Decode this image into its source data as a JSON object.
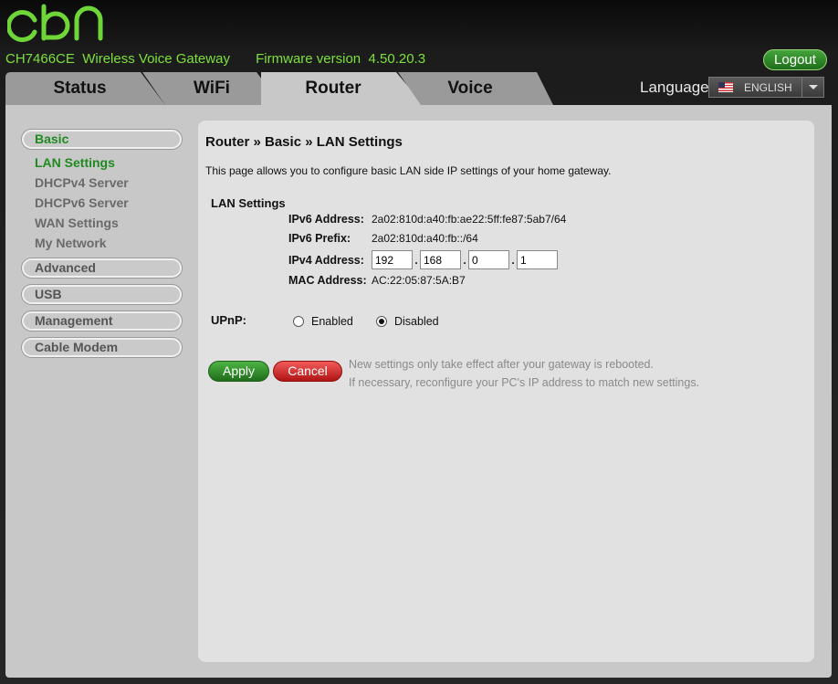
{
  "header": {
    "model": "CH7466CE",
    "product": "Wireless Voice Gateway",
    "firmware_label": "Firmware version",
    "firmware_version": "4.50.20.3",
    "logout_label": "Logout",
    "language_label": "Language",
    "language_value": "ENGLISH"
  },
  "tabs": [
    {
      "label": "Status"
    },
    {
      "label": "WiFi"
    },
    {
      "label": "Router",
      "active": true
    },
    {
      "label": "Voice"
    }
  ],
  "sidebar": {
    "basic": "Basic",
    "items": [
      "LAN Settings",
      "DHCPv4 Server",
      "DHCPv6 Server",
      "WAN Settings",
      "My Network"
    ],
    "advanced": "Advanced",
    "usb": "USB",
    "management": "Management",
    "cable_modem": "Cable Modem"
  },
  "main": {
    "breadcrumb": "Router » Basic » LAN Settings",
    "description": "This page allows you to configure basic LAN side IP settings of your home gateway.",
    "section_title": "LAN Settings",
    "ipv6_address_label": "IPv6 Address:",
    "ipv6_address": "2a02:810d:a40:fb:ae22:5ff:fe87:5ab7/64",
    "ipv6_prefix_label": "IPv6 Prefix:",
    "ipv6_prefix": "2a02:810d:a40:fb::/64",
    "ipv4_address_label": "IPv4 Address:",
    "ipv4_octets": [
      "192",
      "168",
      "0",
      "1"
    ],
    "ipv4_sep": ".",
    "mac_address_label": "MAC Address:",
    "mac_address": "AC:22:05:87:5A:B7",
    "upnp_label": "UPnP:",
    "upnp_enabled": "Enabled",
    "upnp_disabled": "Disabled",
    "upnp_selected": "Disabled",
    "apply_label": "Apply",
    "cancel_label": "Cancel",
    "note_line1": "New settings only take effect after your gateway is rebooted.",
    "note_line2": "If necessary, reconfigure your PC's IP address to match new settings."
  },
  "colors": {
    "accent_green": "#7de03c",
    "active_green": "#1f8a1f",
    "cancel_red": "#d02020"
  },
  "icons": {
    "logo": "cbn-logo",
    "flag": "us-flag-icon",
    "dropdown": "chevron-down-icon"
  }
}
